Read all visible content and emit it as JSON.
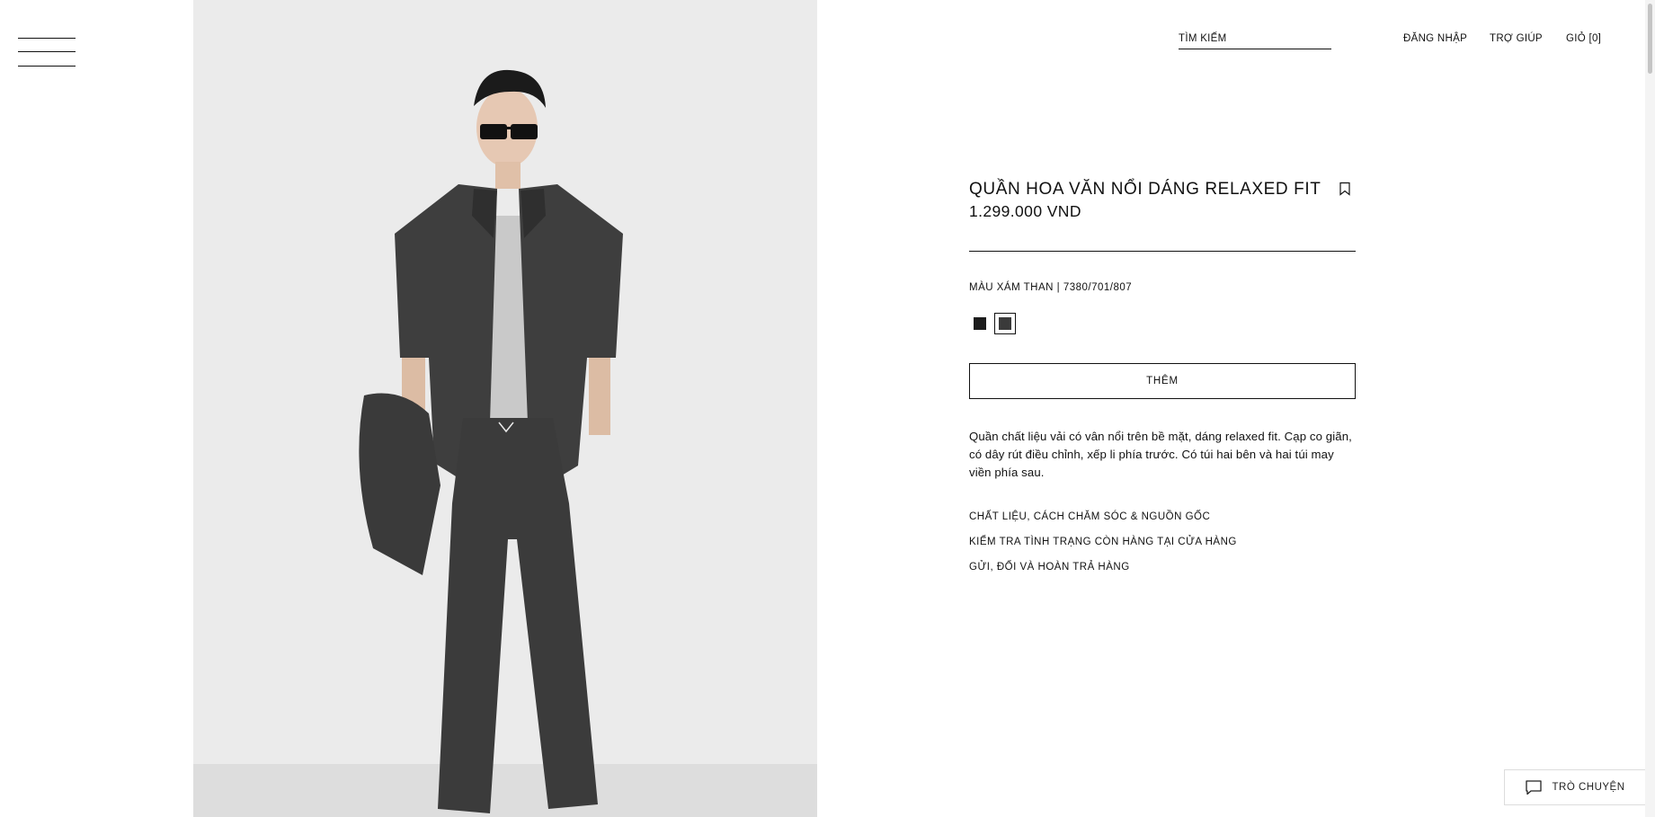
{
  "header": {
    "menu_icon": "hamburger-menu-icon",
    "search_label": "TÌM KIẾM",
    "login_label": "ĐĂNG NHẬP",
    "help_label": "TRỢ GIÚP",
    "cart_label": "GIỎ [0]"
  },
  "product": {
    "title": "QUẦN HOA VĂN NỔI DÁNG RELAXED FIT",
    "price": "1.299.000 VND",
    "color_line": "MÀU XÁM THAN | 7380/701/807",
    "swatches": [
      {
        "color": "#1c1c1c",
        "selected": false
      },
      {
        "color": "#3a3a3a",
        "selected": true
      }
    ],
    "add_button": "THÊM",
    "description": "Quần chất liệu vải có vân nổi trên bề mặt, dáng relaxed fit. Cạp co giãn, có dây rút điều chỉnh, xếp li phía trước. Có túi hai bên và hai túi may viền phía sau.",
    "links": [
      "CHẤT LIỆU, CÁCH CHĂM SÓC & NGUỒN GỐC",
      "KIỂM TRA TÌNH TRẠNG CÒN HÀNG TẠI CỬA HÀNG",
      "GỬI, ĐỔI VÀ HOÀN TRẢ HÀNG"
    ],
    "bookmark_icon": "bookmark-icon"
  },
  "chat": {
    "label": "TRÒ CHUYỆN",
    "icon": "chat-bubble-icon"
  }
}
